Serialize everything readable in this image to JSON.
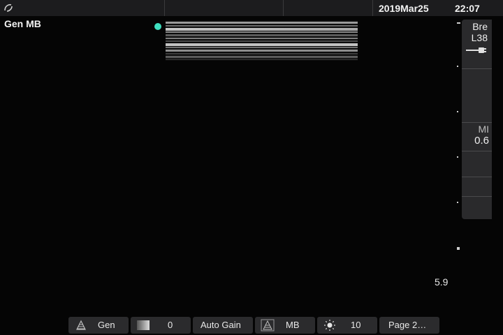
{
  "header": {
    "date": "2019Mar25",
    "time": "22:07"
  },
  "preset_label": "Gen MB",
  "depth": {
    "value": "5.9"
  },
  "side_panel": {
    "exam_line1": "Bre",
    "exam_line2": "L38",
    "mi_label": "MI",
    "mi_value": "0.6"
  },
  "toolbar": {
    "mode_label": "Gen",
    "gain_value": "0",
    "auto_gain_label": "Auto Gain",
    "mb_label": "MB",
    "brightness_value": "10",
    "page_label": "Page 2…"
  },
  "colors": {
    "cursor_dot": "#3fe0c0",
    "background": "#050505",
    "bar": "#2b2b2d"
  },
  "icons": [
    "logo-icon",
    "probe-icon",
    "mode-icon",
    "gain-icon",
    "mb-icon",
    "brightness-icon"
  ]
}
